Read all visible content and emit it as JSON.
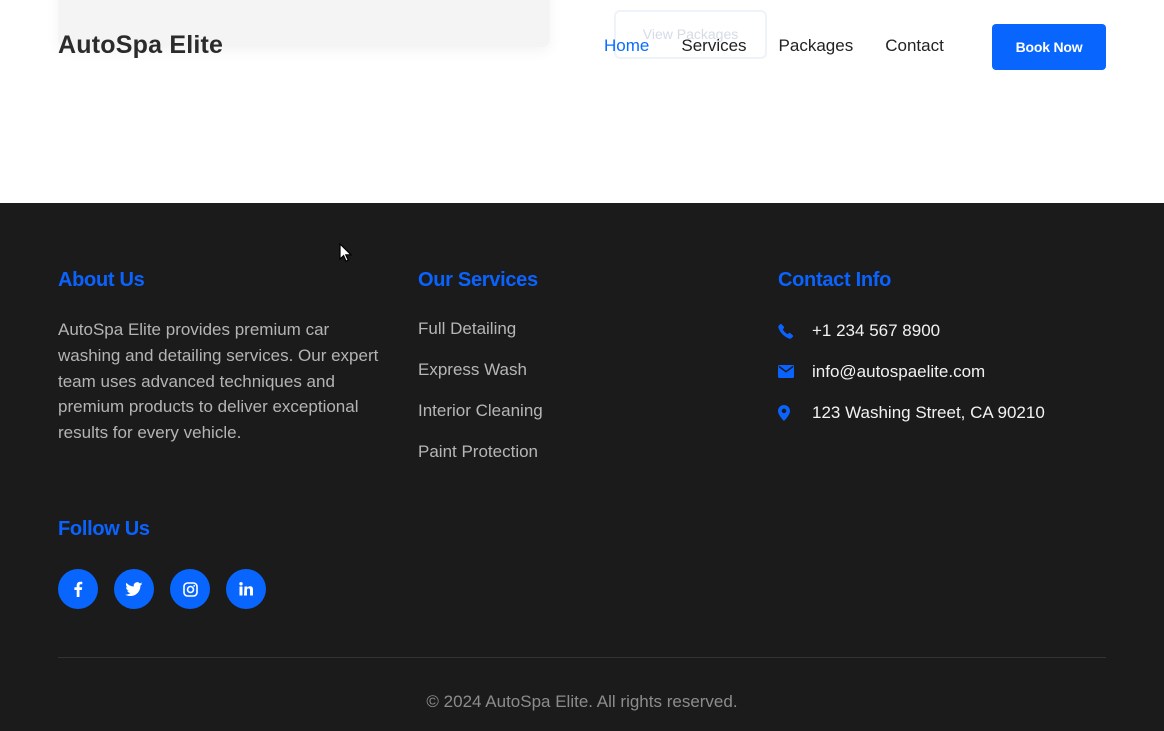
{
  "background_section": {
    "ghost_button_label": "View Packages"
  },
  "header": {
    "logo": "AutoSpa Elite",
    "nav": [
      {
        "label": "Home",
        "active": true
      },
      {
        "label": "Services",
        "active": false
      },
      {
        "label": "Packages",
        "active": false
      },
      {
        "label": "Contact",
        "active": false
      }
    ],
    "cta_label": "Book Now"
  },
  "footer": {
    "about": {
      "title": "About Us",
      "text": "AutoSpa Elite provides premium car washing and detailing services. Our expert team uses advanced techniques and premium products to deliver exceptional results for every vehicle."
    },
    "services": {
      "title": "Our Services",
      "items": [
        "Full Detailing",
        "Express Wash",
        "Interior Cleaning",
        "Paint Protection"
      ]
    },
    "contact": {
      "title": "Contact Info",
      "phone": "+1 234 567 8900",
      "email": "info@autospaelite.com",
      "address": "123 Washing Street, CA 90210"
    },
    "follow": {
      "title": "Follow Us",
      "icons": [
        "facebook-icon",
        "twitter-icon",
        "instagram-icon",
        "linkedin-icon"
      ]
    },
    "copyright": "© 2024 AutoSpa Elite. All rights reserved."
  },
  "colors": {
    "accent": "#0866ff",
    "footer_bg": "#1b1b1c"
  }
}
